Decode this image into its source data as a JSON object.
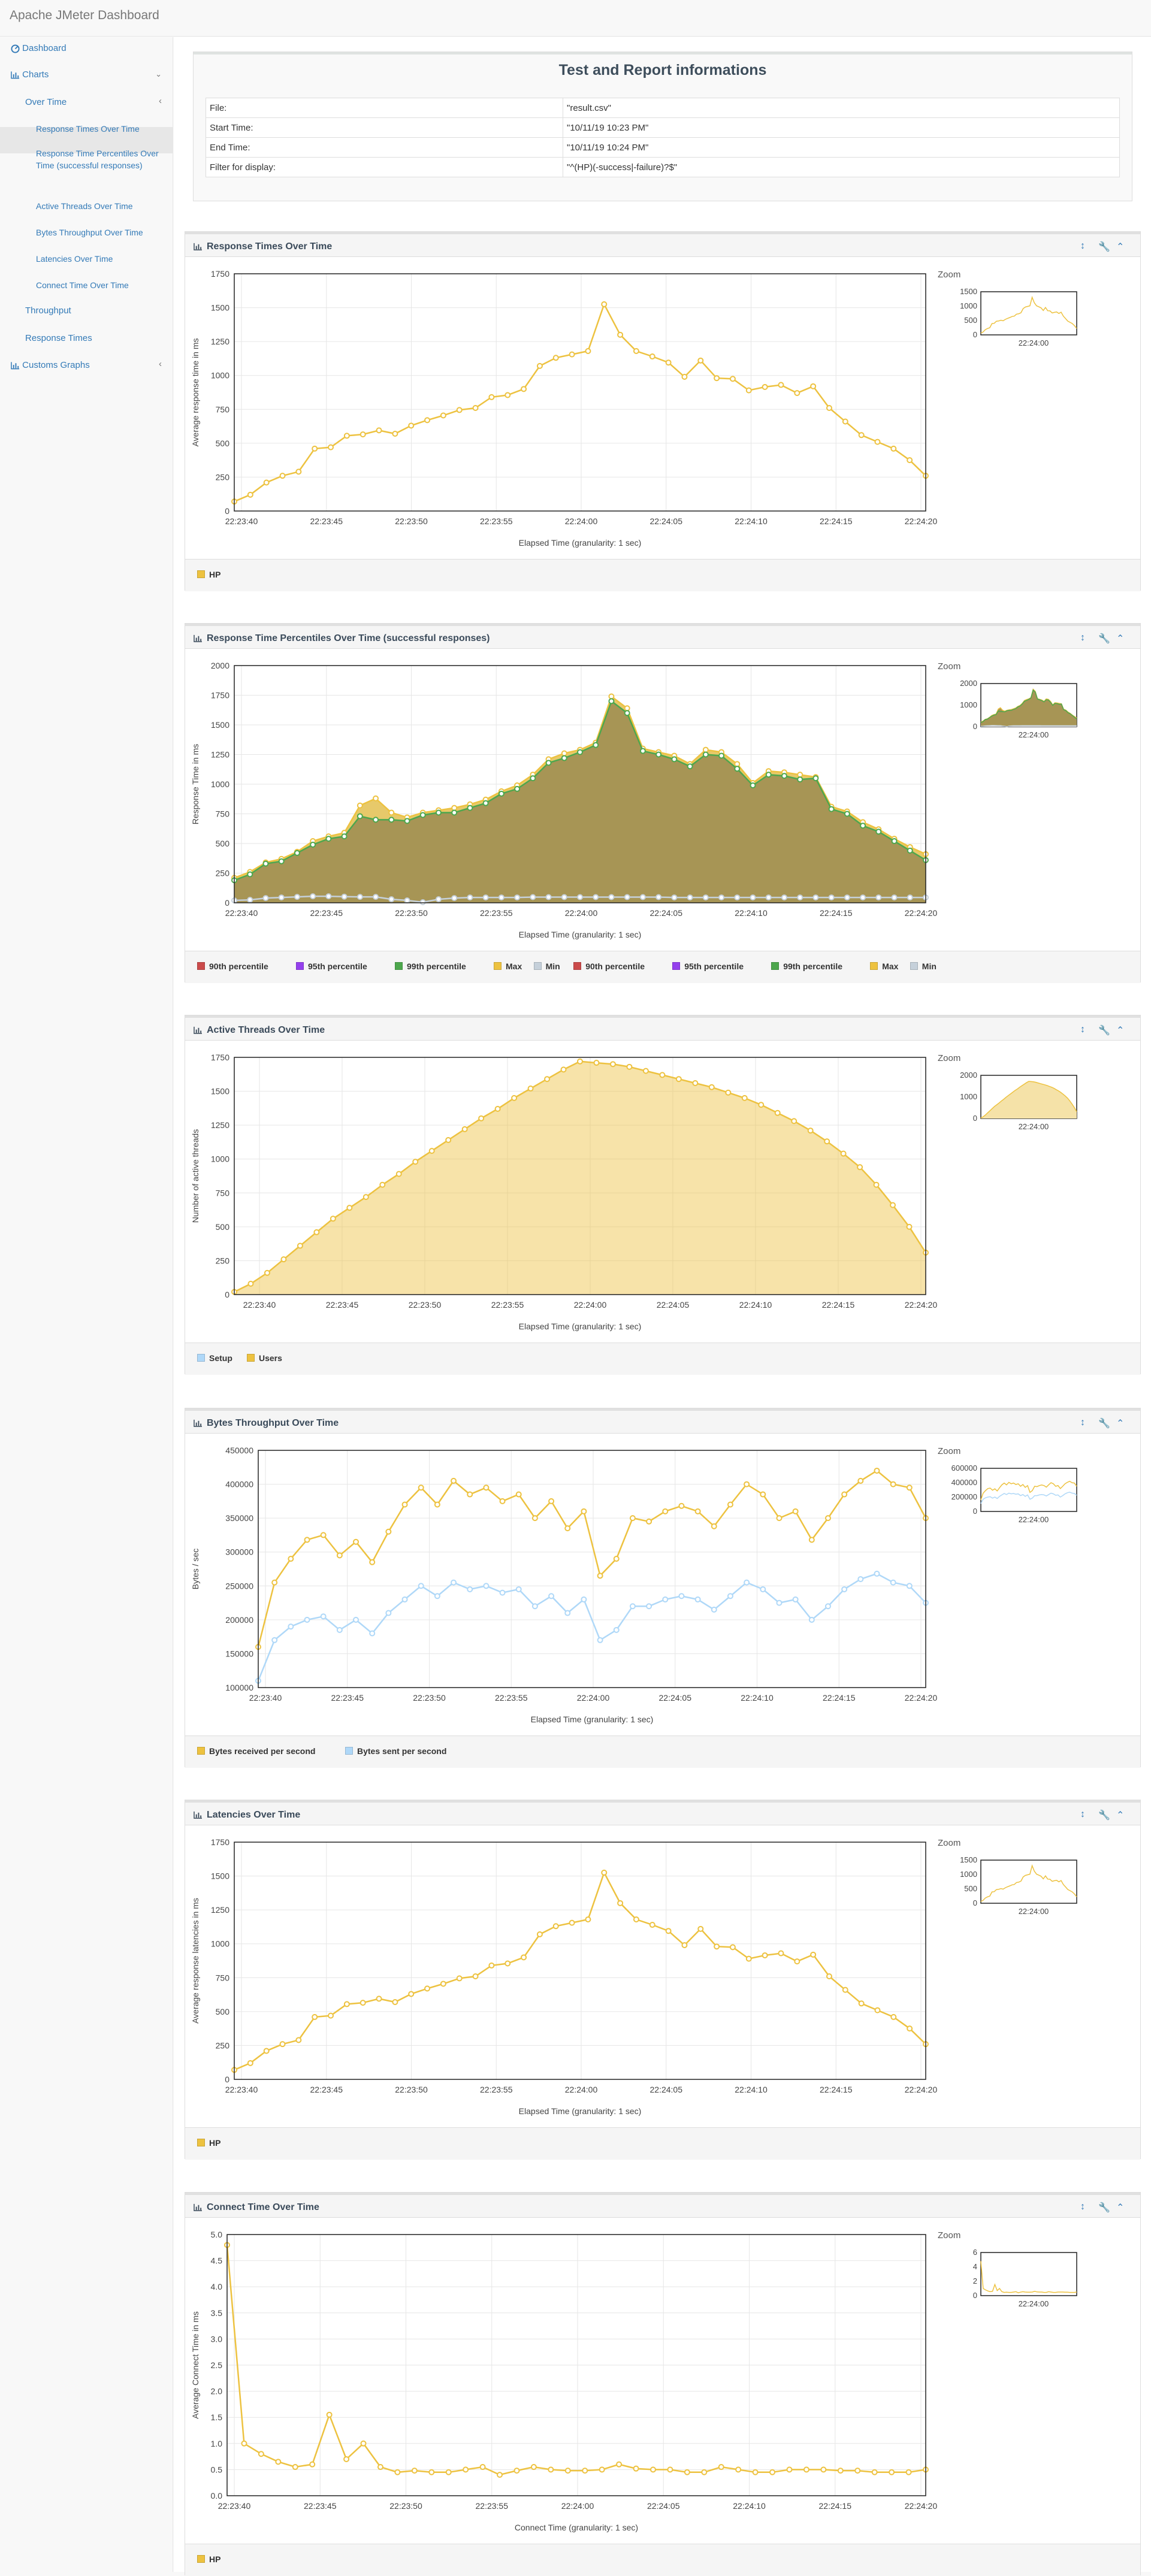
{
  "app": {
    "title": "Apache JMeter Dashboard"
  },
  "sidebar": {
    "dashboard": "Dashboard",
    "charts": "Charts",
    "over_time": "Over Time",
    "items": [
      "Response Times Over Time",
      "Response Time Percentiles Over Time (successful responses)",
      "Active Threads Over Time",
      "Bytes Throughput Over Time",
      "Latencies Over Time",
      "Connect Time Over Time"
    ],
    "throughput": "Throughput",
    "response_times": "Response Times",
    "customs": "Customs Graphs"
  },
  "report": {
    "title": "Test and Report informations",
    "rows": [
      [
        "File:",
        "\"result.csv\""
      ],
      [
        "Start Time:",
        "\"10/11/19 10:23 PM\""
      ],
      [
        "End Time:",
        "\"10/11/19 10:24 PM\""
      ],
      [
        "Filter for display:",
        "\"^(HP)(-success|-failure)?$\""
      ]
    ]
  },
  "zoom_label": "Zoom",
  "zoom_tick": "22:24:00",
  "colors": {
    "yellow": "#edc240",
    "fill_yellow": "#f5e2a8",
    "light_blue": "#afd8f8",
    "red": "#cb4b4b",
    "purple": "#9440ed",
    "green": "#4da74d",
    "olive": "#a79555",
    "grey": "#c5d0da",
    "link": "#337ab7"
  },
  "time_ticks": [
    "22:23:40",
    "22:23:45",
    "22:23:50",
    "22:23:55",
    "22:24:00",
    "22:24:05",
    "22:24:10",
    "22:24:15",
    "22:24:20"
  ],
  "panels": [
    {
      "title": "Response Times Over Time",
      "xlabel": "Elapsed Time (granularity: 1 sec)",
      "ylabel": "Average response time in ms",
      "legend": [
        {
          "label": "HP",
          "color": "#edc240"
        }
      ],
      "chart_data": {
        "type": "line",
        "ylim": [
          0,
          1750
        ],
        "yticks": [
          "0",
          "250",
          "500",
          "750",
          "1000",
          "1250",
          "1500",
          "1750"
        ],
        "series": [
          {
            "name": "HP",
            "color": "#edc240",
            "values": [
              70,
              120,
              210,
              260,
              290,
              460,
              470,
              555,
              565,
              595,
              570,
              630,
              670,
              705,
              745,
              760,
              840,
              855,
              900,
              1070,
              1130,
              1155,
              1180,
              1525,
              1300,
              1180,
              1140,
              1095,
              990,
              1110,
              980,
              975,
              890,
              915,
              930,
              870,
              920,
              760,
              660,
              560,
              510,
              460,
              375,
              260
            ]
          }
        ],
        "zoom_yticks": [
          "0",
          "500",
          "1000",
          "1500"
        ],
        "zoom_max": 1750
      }
    },
    {
      "title": "Response Time Percentiles Over Time (successful responses)",
      "xlabel": "Elapsed Time (granularity: 1 sec)",
      "ylabel": "Response Time in ms",
      "legend": [
        {
          "label": "90th percentile",
          "color": "#cb4b4b"
        },
        {
          "label": "95th percentile",
          "color": "#9440ed"
        },
        {
          "label": "99th percentile",
          "color": "#4da74d"
        },
        {
          "label": "Max",
          "color": "#edc240"
        },
        {
          "label": "Min",
          "color": "#c5d0da"
        },
        {
          "label": "90th percentile",
          "color": "#cb4b4b"
        },
        {
          "label": "95th percentile",
          "color": "#9440ed"
        },
        {
          "label": "99th percentile",
          "color": "#4da74d"
        },
        {
          "label": "Max",
          "color": "#edc240"
        },
        {
          "label": "Min",
          "color": "#c5d0da"
        }
      ],
      "chart_data": {
        "type": "area",
        "ylim": [
          0,
          2000
        ],
        "yticks": [
          "0",
          "250",
          "500",
          "750",
          "1000",
          "1250",
          "1500",
          "1750",
          "2000"
        ],
        "series": [
          {
            "name": "Max",
            "color": "#edc240",
            "values": [
              210,
              260,
              340,
              370,
              430,
              520,
              560,
              590,
              820,
              880,
              760,
              720,
              760,
              780,
              800,
              830,
              870,
              940,
              990,
              1080,
              1210,
              1260,
              1290,
              1350,
              1740,
              1640,
              1300,
              1270,
              1240,
              1170,
              1290,
              1270,
              1170,
              1010,
              1110,
              1100,
              1080,
              1060,
              810,
              770,
              680,
              620,
              540,
              470,
              410
            ]
          },
          {
            "name": "99th percentile",
            "color": "#4da74d",
            "values": [
              190,
              240,
              330,
              350,
              420,
              490,
              540,
              560,
              730,
              700,
              700,
              690,
              740,
              760,
              760,
              800,
              840,
              920,
              960,
              1050,
              1180,
              1220,
              1270,
              1330,
              1700,
              1600,
              1280,
              1250,
              1210,
              1150,
              1250,
              1240,
              1130,
              990,
              1080,
              1070,
              1040,
              1050,
              790,
              750,
              650,
              600,
              520,
              440,
              360
            ]
          },
          {
            "name": "Min",
            "color": "#c5d0da",
            "values": [
              20,
              25,
              40,
              45,
              50,
              55,
              55,
              52,
              50,
              50,
              30,
              20,
              5,
              30,
              40,
              45,
              45,
              45,
              45,
              48,
              48,
              48,
              48,
              48,
              48,
              48,
              48,
              48,
              45,
              45,
              45,
              45,
              45,
              45,
              45,
              45,
              45,
              45,
              45,
              45,
              45,
              45,
              45,
              45,
              45
            ]
          }
        ],
        "zoom_yticks": [
          "0",
          "1000",
          "2000"
        ],
        "zoom_max": 2000
      }
    },
    {
      "title": "Active Threads Over Time",
      "xlabel": "Elapsed Time (granularity: 1 sec)",
      "ylabel": "Number of active threads",
      "legend": [
        {
          "label": "Setup",
          "color": "#afd8f8"
        },
        {
          "label": "Users",
          "color": "#edc240"
        }
      ],
      "chart_data": {
        "type": "area",
        "ylim": [
          0,
          1750
        ],
        "yticks": [
          "0",
          "250",
          "500",
          "750",
          "1000",
          "1250",
          "1500",
          "1750"
        ],
        "series": [
          {
            "name": "Users",
            "color": "#edc240",
            "values": [
              20,
              80,
              160,
              260,
              360,
              460,
              560,
              640,
              720,
              810,
              890,
              980,
              1060,
              1140,
              1220,
              1300,
              1370,
              1450,
              1520,
              1590,
              1660,
              1720,
              1710,
              1700,
              1680,
              1650,
              1620,
              1590,
              1560,
              1530,
              1490,
              1450,
              1400,
              1340,
              1280,
              1210,
              1130,
              1040,
              940,
              810,
              660,
              500,
              310
            ]
          }
        ],
        "zoom_yticks": [
          "0",
          "1000",
          "2000"
        ],
        "zoom_max": 2000
      }
    },
    {
      "title": "Bytes Throughput Over Time",
      "xlabel": "Elapsed Time (granularity: 1 sec)",
      "ylabel": "Bytes / sec",
      "legend": [
        {
          "label": "Bytes received per second",
          "color": "#edc240"
        },
        {
          "label": "Bytes sent per second",
          "color": "#afd8f8"
        }
      ],
      "chart_data": {
        "type": "line",
        "ylim": [
          100000,
          450000
        ],
        "yticks": [
          "100000",
          "150000",
          "200000",
          "250000",
          "300000",
          "350000",
          "400000",
          "450000"
        ],
        "series": [
          {
            "name": "Bytes received per second",
            "color": "#edc240",
            "values": [
              160000,
              255000,
              290000,
              318000,
              325000,
              295000,
              315000,
              285000,
              330000,
              370000,
              395000,
              370000,
              405000,
              385000,
              395000,
              375000,
              385000,
              350000,
              375000,
              335000,
              360000,
              265000,
              290000,
              350000,
              345000,
              360000,
              368000,
              360000,
              338000,
              370000,
              400000,
              385000,
              350000,
              360000,
              318000,
              350000,
              385000,
              405000,
              420000,
              400000,
              395000,
              350000
            ]
          },
          {
            "name": "Bytes sent per second",
            "color": "#afd8f8",
            "values": [
              110000,
              170000,
              190000,
              200000,
              205000,
              185000,
              200000,
              180000,
              210000,
              230000,
              250000,
              235000,
              255000,
              245000,
              250000,
              240000,
              245000,
              220000,
              235000,
              210000,
              230000,
              170000,
              185000,
              220000,
              220000,
              230000,
              235000,
              230000,
              215000,
              235000,
              255000,
              245000,
              225000,
              230000,
              200000,
              220000,
              245000,
              260000,
              268000,
              255000,
              250000,
              225000
            ]
          }
        ],
        "zoom_yticks": [
          "0",
          "200000",
          "400000",
          "600000"
        ],
        "zoom_max": 600000
      }
    },
    {
      "title": "Latencies Over Time",
      "xlabel": "Elapsed Time (granularity: 1 sec)",
      "ylabel": "Average response latencies in ms",
      "legend": [
        {
          "label": "HP",
          "color": "#edc240"
        }
      ],
      "chart_data": {
        "type": "line",
        "ylim": [
          0,
          1750
        ],
        "yticks": [
          "0",
          "250",
          "500",
          "750",
          "1000",
          "1250",
          "1500",
          "1750"
        ],
        "series": [
          {
            "name": "HP",
            "color": "#edc240",
            "values": [
              70,
              120,
              210,
              260,
              290,
              460,
              470,
              555,
              565,
              595,
              570,
              630,
              670,
              705,
              745,
              760,
              840,
              855,
              900,
              1070,
              1130,
              1155,
              1180,
              1525,
              1300,
              1180,
              1140,
              1095,
              990,
              1110,
              980,
              975,
              890,
              915,
              930,
              870,
              920,
              760,
              660,
              560,
              510,
              460,
              375,
              260
            ]
          }
        ],
        "zoom_yticks": [
          "0",
          "500",
          "1000",
          "1500"
        ],
        "zoom_max": 1750
      }
    },
    {
      "title": "Connect Time Over Time",
      "xlabel": "Connect Time (granularity: 1 sec)",
      "ylabel": "Average Connect Time in ms",
      "legend": [
        {
          "label": "HP",
          "color": "#edc240"
        }
      ],
      "chart_data": {
        "type": "line",
        "ylim": [
          0,
          5
        ],
        "yticks": [
          "0.0",
          "0.5",
          "1.0",
          "1.5",
          "2.0",
          "2.5",
          "3.0",
          "3.5",
          "4.0",
          "4.5",
          "5.0"
        ],
        "series": [
          {
            "name": "HP",
            "color": "#edc240",
            "values": [
              4.8,
              1.0,
              0.8,
              0.65,
              0.55,
              0.6,
              1.55,
              0.7,
              1.0,
              0.55,
              0.45,
              0.48,
              0.45,
              0.45,
              0.5,
              0.55,
              0.4,
              0.48,
              0.55,
              0.5,
              0.48,
              0.48,
              0.5,
              0.6,
              0.52,
              0.5,
              0.5,
              0.45,
              0.45,
              0.55,
              0.5,
              0.45,
              0.45,
              0.5,
              0.5,
              0.5,
              0.48,
              0.48,
              0.45,
              0.45,
              0.45,
              0.5
            ]
          }
        ],
        "zoom_yticks": [
          "0",
          "2",
          "4",
          "6"
        ],
        "zoom_max": 6
      }
    }
  ]
}
